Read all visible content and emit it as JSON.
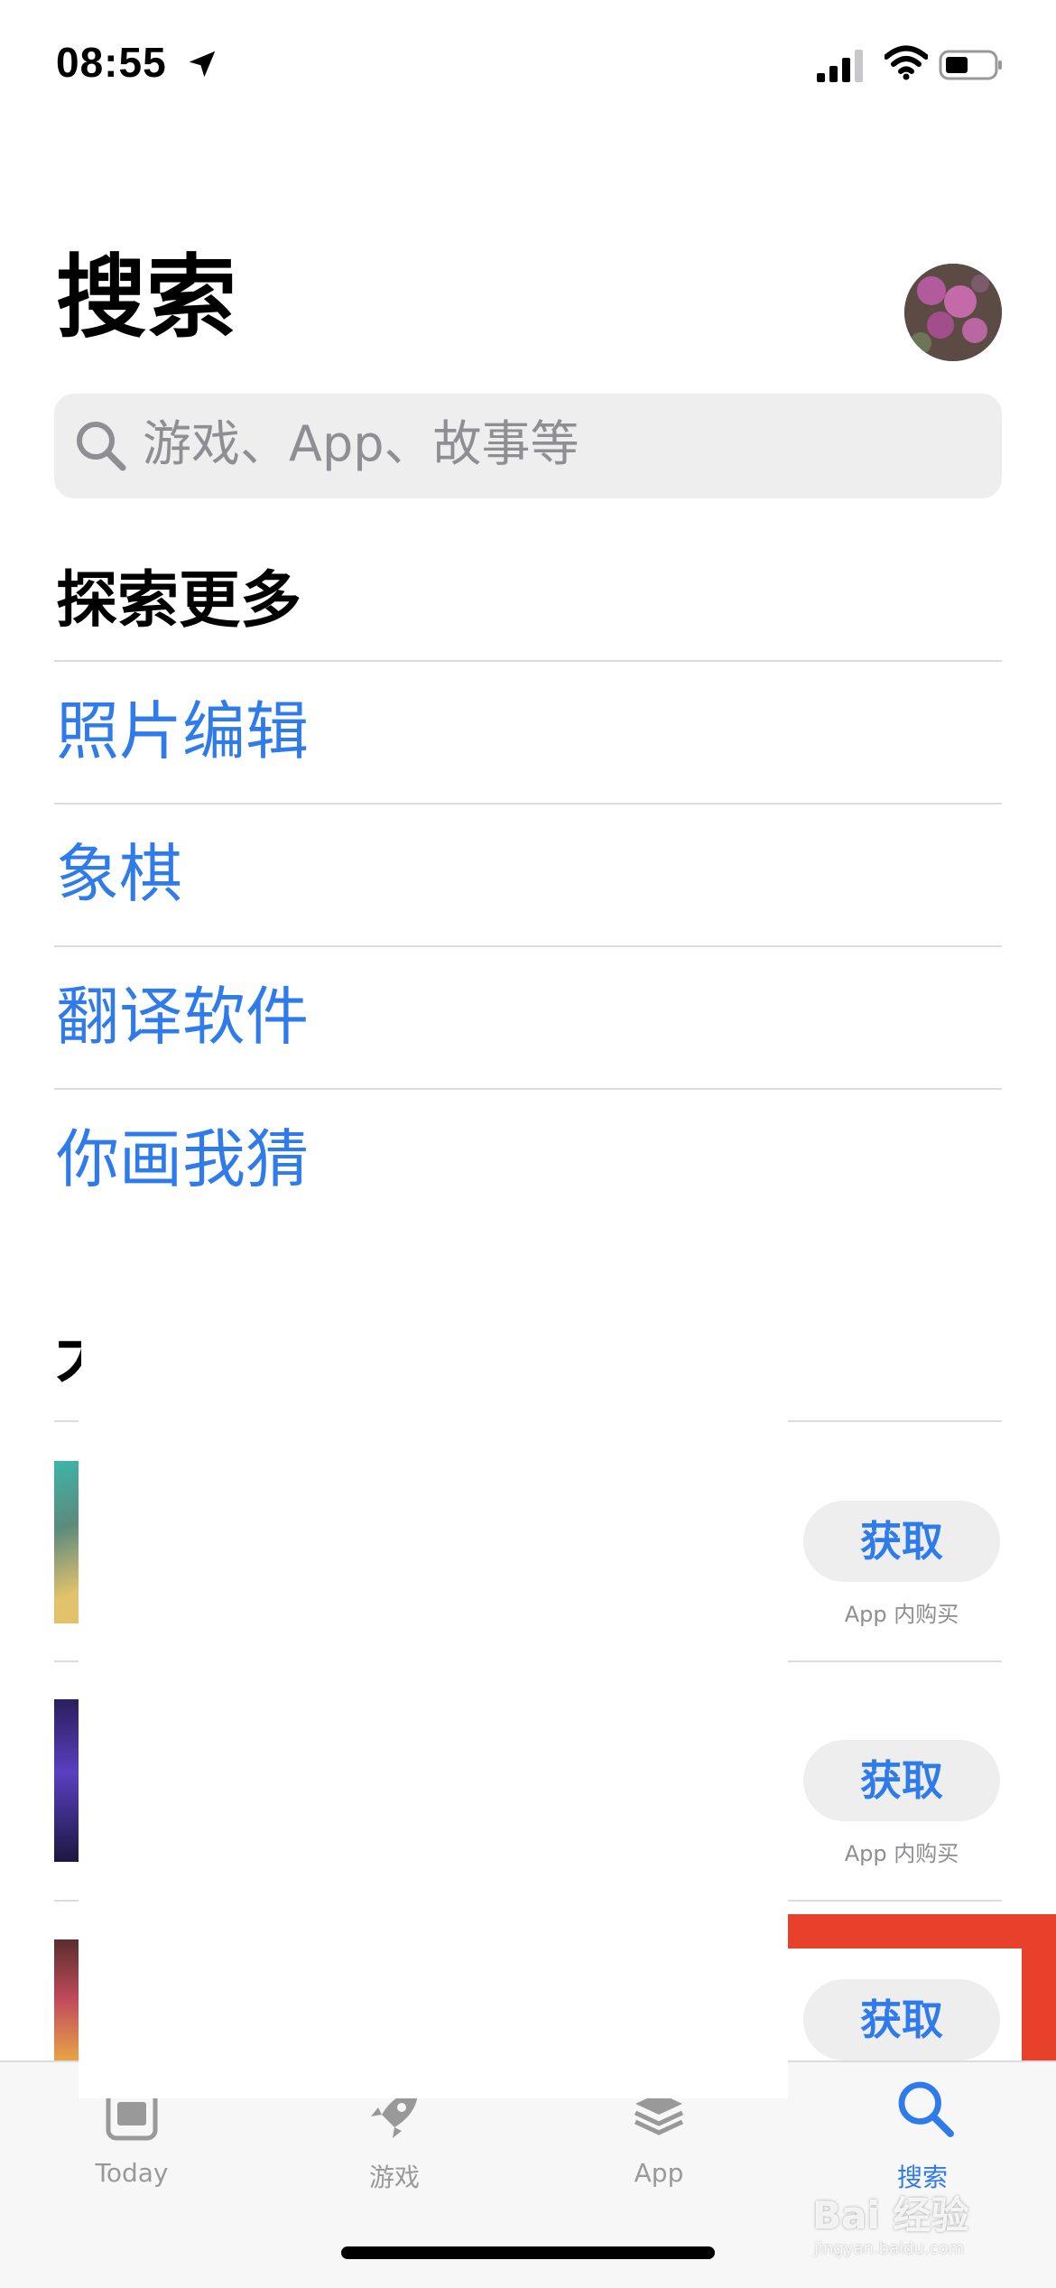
{
  "status_bar": {
    "time": "08:55"
  },
  "header": {
    "title": "搜索"
  },
  "search": {
    "placeholder": "游戏、App、故事等"
  },
  "explore": {
    "title": "探索更多",
    "items": [
      "照片编辑",
      "象棋",
      "翻译软件",
      "你画我猜"
    ]
  },
  "ads": {
    "title_partial": "大",
    "rows": [
      {
        "button": "获取",
        "note": "App 内购买"
      },
      {
        "button": "获取",
        "note": "App 内购买"
      },
      {
        "button": "获取",
        "note": ""
      }
    ]
  },
  "tabbar": {
    "tabs": [
      {
        "label": "Today",
        "icon": "today-icon"
      },
      {
        "label": "游戏",
        "icon": "rocket-icon"
      },
      {
        "label": "App",
        "icon": "app-stack-icon"
      },
      {
        "label": "搜索",
        "icon": "search-icon"
      }
    ],
    "active_color": "#2f7bea"
  },
  "watermark": {
    "brand": "Bai 经验",
    "url": "jingyan.baidu.com"
  },
  "colors": {
    "accent": "#2f7bea",
    "highlight": "#e7412b"
  }
}
